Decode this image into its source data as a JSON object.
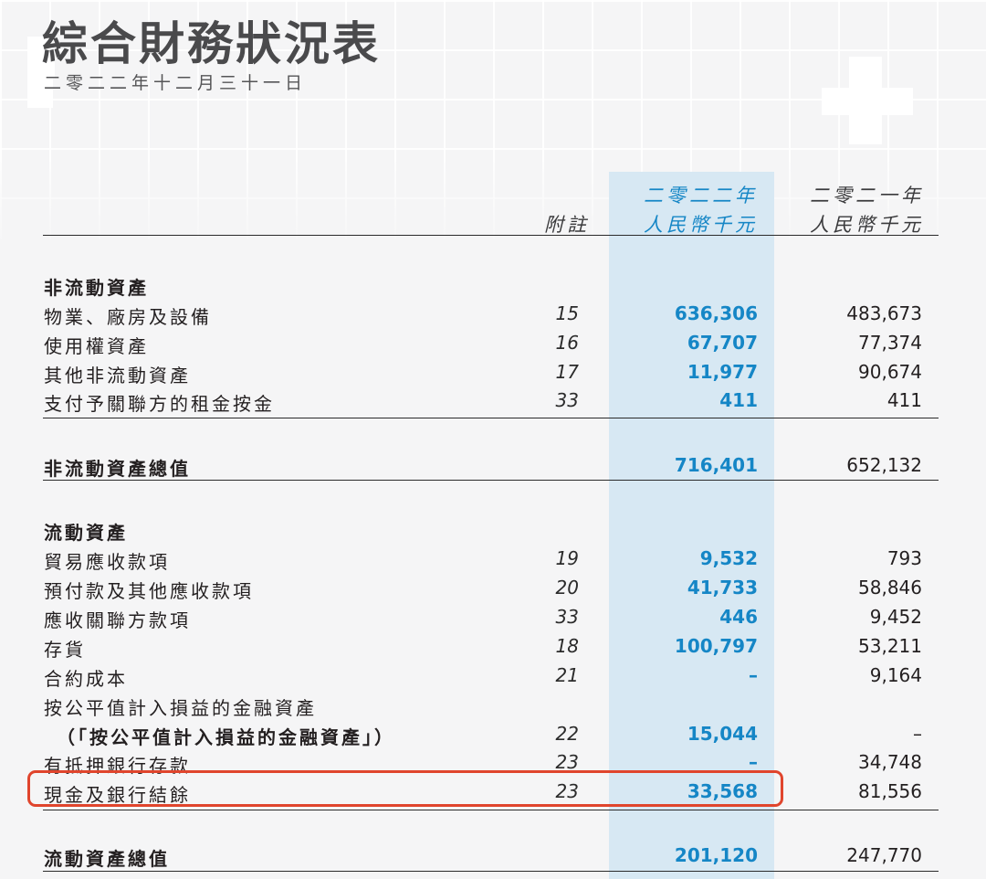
{
  "header": {
    "title": "綜合財務狀況表",
    "date": "二零二二年十二月三十一日"
  },
  "columns": {
    "note": "附註",
    "current_year": "二零二二年",
    "current_unit": "人民幣千元",
    "prior_year": "二零二一年",
    "prior_unit": "人民幣千元"
  },
  "colors": {
    "current_value": "#1586c6",
    "current_band": "#d7e8f3",
    "highlight_border": "#e0452d"
  },
  "sections": {
    "non_current_assets": {
      "heading": "非流動資產",
      "rows": [
        {
          "label": "物業、廠房及設備",
          "note": "15",
          "current": "636,306",
          "prior": "483,673"
        },
        {
          "label": "使用權資產",
          "note": "16",
          "current": "67,707",
          "prior": "77,374"
        },
        {
          "label": "其他非流動資產",
          "note": "17",
          "current": "11,977",
          "prior": "90,674"
        },
        {
          "label": "支付予關聯方的租金按金",
          "note": "33",
          "current": "411",
          "prior": "411"
        }
      ],
      "total": {
        "label": "非流動資產總值",
        "current": "716,401",
        "prior": "652,132"
      }
    },
    "current_assets": {
      "heading": "流動資產",
      "rows": [
        {
          "label": "貿易應收款項",
          "note": "19",
          "current": "9,532",
          "prior": "793"
        },
        {
          "label": "預付款及其他應收款項",
          "note": "20",
          "current": "41,733",
          "prior": "58,846"
        },
        {
          "label": "應收關聯方款項",
          "note": "33",
          "current": "446",
          "prior": "9,452"
        },
        {
          "label": "存貨",
          "note": "18",
          "current": "100,797",
          "prior": "53,211"
        },
        {
          "label": "合約成本",
          "note": "21",
          "current": "–",
          "prior": "9,164"
        },
        {
          "label": "按公平值計入損益的金融資產",
          "note": "",
          "current": "",
          "prior": ""
        },
        {
          "label": "（「按公平值計入損益的金融資產」）",
          "note": "22",
          "current": "15,044",
          "prior": "–"
        },
        {
          "label": "有抵押銀行存款",
          "note": "23",
          "current": "–",
          "prior": "34,748"
        },
        {
          "label": "現金及銀行結餘",
          "note": "23",
          "current": "33,568",
          "prior": "81,556"
        }
      ],
      "total": {
        "label": "流動資產總值",
        "current": "201,120",
        "prior": "247,770"
      }
    }
  }
}
